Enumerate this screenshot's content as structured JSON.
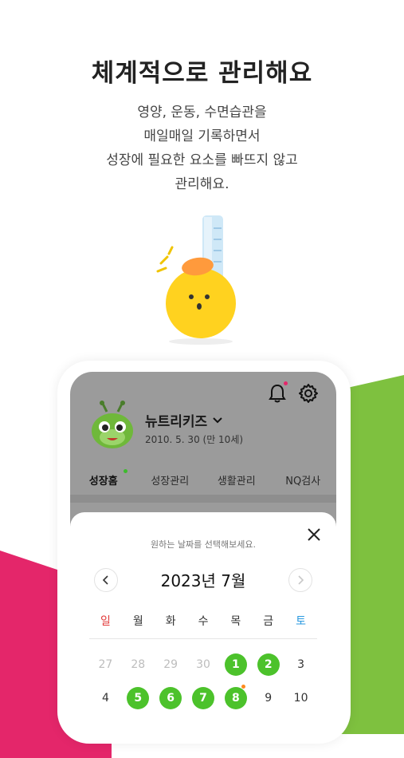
{
  "headline": "체계적으로 관리해요",
  "description": [
    "영양, 운동, 수면습관을",
    "매일매일 기록하면서",
    "성장에 필요한 요소를 빠뜨지 않고",
    "관리해요."
  ],
  "app": {
    "profile": {
      "name": "뉴트리키즈",
      "birth": "2010. 5. 30 (만 10세)"
    },
    "tabs": [
      "성장홈",
      "성장관리",
      "생활관리",
      "NQ검사"
    ],
    "active_tab": "성장홈",
    "calendar": {
      "hint": "원하는 날짜를 선택해보세요.",
      "month": "2023년 7월",
      "weekdays": [
        "일",
        "월",
        "화",
        "수",
        "목",
        "금",
        "토"
      ],
      "weeks": [
        [
          "27",
          "28",
          "29",
          "30",
          "1",
          "2",
          "3"
        ],
        [
          "4",
          "5",
          "6",
          "7",
          "8",
          "9",
          "10"
        ]
      ]
    }
  },
  "colors": {
    "brand_green": "#4cc22b",
    "pink": "#e4266a",
    "sunday": "#e23a3a",
    "saturday": "#2b9ae0"
  },
  "icons": [
    "bell-icon",
    "gear-icon",
    "chevron-down-icon",
    "close-icon",
    "chevron-left-icon",
    "chevron-right-icon"
  ]
}
